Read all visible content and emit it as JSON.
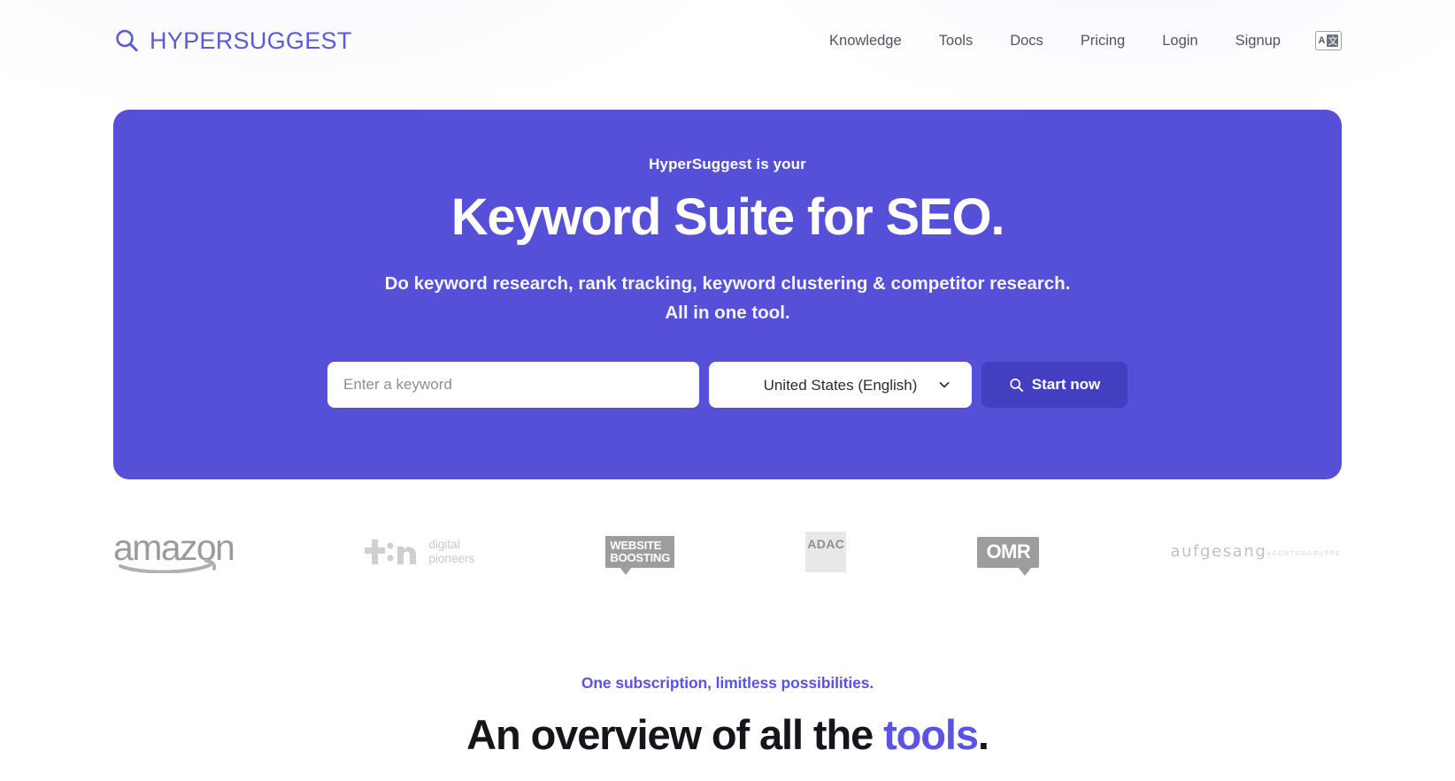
{
  "header": {
    "logo": {
      "icon": "search-icon",
      "text": "HYPERSUGGEST"
    },
    "nav": [
      {
        "label": "Knowledge"
      },
      {
        "label": "Tools"
      },
      {
        "label": "Docs"
      },
      {
        "label": "Pricing"
      },
      {
        "label": "Login"
      },
      {
        "label": "Signup"
      }
    ],
    "language_switcher": {
      "icon": "translate-icon",
      "left_glyph": "A",
      "right_glyph": "文"
    }
  },
  "hero": {
    "eyebrow": "HyperSuggest is your",
    "title": "Keyword Suite for SEO.",
    "subtitle_line1": "Do keyword research, rank tracking, keyword clustering & competitor research.",
    "subtitle_line2": "All in one tool.",
    "form": {
      "keyword_placeholder": "Enter a keyword",
      "keyword_value": "",
      "country_selected": "United States (English)",
      "country_chevron": "chevron-down-icon",
      "submit_label": "Start now",
      "submit_icon": "search-icon"
    },
    "background_color": "#5650d8",
    "submit_color": "#443ec0"
  },
  "logo_strip": {
    "brands": [
      {
        "name": "amazon",
        "label": "amazon"
      },
      {
        "name": "t3n",
        "label": "t3n",
        "sub_line1": "digital",
        "sub_line2": "pioneers"
      },
      {
        "name": "website-boosting",
        "label_line1": "WEBSITE",
        "label_line2": "BOOSTING"
      },
      {
        "name": "adac",
        "label": "ADAC"
      },
      {
        "name": "omr",
        "label": "OMR"
      },
      {
        "name": "aufgesang",
        "label": "aufgesang",
        "sub": "AGENTURGRUPPE"
      }
    ]
  },
  "tools_section": {
    "eyebrow": "One subscription, limitless possibilities.",
    "title_prefix": "An overview of all the ",
    "title_accent": "tools",
    "title_suffix": ".",
    "accent_color": "#5b52e8"
  }
}
